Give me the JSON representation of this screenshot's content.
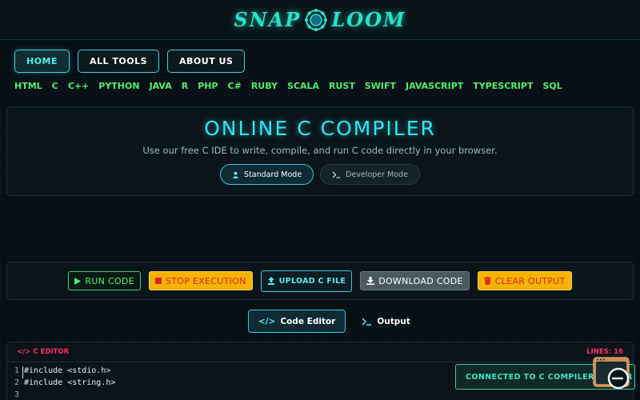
{
  "brand": {
    "left": "SNAP",
    "right": "LOOM"
  },
  "nav": [
    {
      "label": "HOME",
      "active": true
    },
    {
      "label": "ALL TOOLS",
      "active": false
    },
    {
      "label": "ABOUT US",
      "active": false
    }
  ],
  "languages": [
    "HTML",
    "C",
    "C++",
    "PYTHON",
    "JAVA",
    "R",
    "PHP",
    "C#",
    "RUBY",
    "SCALA",
    "RUST",
    "SWIFT",
    "JAVASCRIPT",
    "TYPESCRIPT",
    "SQL"
  ],
  "hero": {
    "title": "ONLINE C COMPILER",
    "subtitle": "Use our free C IDE to write, compile, and run C code directly in your browser.",
    "standard_mode": "Standard Mode",
    "developer_mode": "Developer Mode"
  },
  "actions": {
    "run": "RUN CODE",
    "stop": "STOP EXECUTION",
    "upload": "UPLOAD C FILE",
    "download": "DOWNLOAD CODE",
    "clear": "CLEAR OUTPUT"
  },
  "tabs": {
    "editor": "Code Editor",
    "output": "Output"
  },
  "editor": {
    "label": "C EDITOR",
    "lines_label": "LINES: 16",
    "code": [
      {
        "n": "1",
        "text": "#include <stdio.h>"
      },
      {
        "n": "2",
        "text": "#include <string.h>"
      },
      {
        "n": "3",
        "text": ""
      }
    ]
  },
  "toast": "CONNECTED TO C COMPILER SERVER",
  "colors": {
    "accent": "#36e2f0",
    "lang": "#4ef06a",
    "warn": "#f5b400",
    "danger": "#e02030",
    "label": "#ff2d6a"
  }
}
